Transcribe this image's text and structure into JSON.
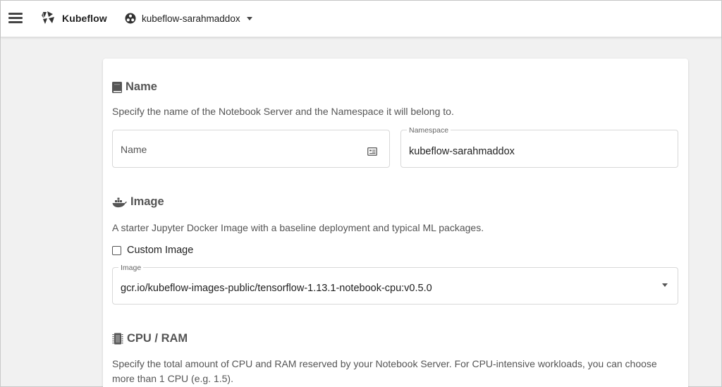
{
  "topbar": {
    "brand": "Kubeflow",
    "namespace_selector": "kubeflow-sarahmaddox",
    "icons": [
      "menu-icon",
      "kubeflow-logo",
      "namespace-icon",
      "caret-down-icon"
    ]
  },
  "name_section": {
    "title": "Name",
    "description": "Specify the name of the Notebook Server and the Namespace it will belong to.",
    "name_field": {
      "placeholder": "Name",
      "value": ""
    },
    "namespace_field": {
      "label": "Namespace",
      "value": "kubeflow-sarahmaddox"
    }
  },
  "image_section": {
    "title": "Image",
    "description": "A starter Jupyter Docker Image with a baseline deployment and typical ML packages.",
    "custom_image_label": "Custom Image",
    "custom_image_checked": false,
    "image_field": {
      "label": "Image",
      "value": "gcr.io/kubeflow-images-public/tensorflow-1.13.1-notebook-cpu:v0.5.0"
    }
  },
  "cpu_section": {
    "title": "CPU / RAM",
    "description_line1": "Specify the total amount of CPU and RAM reserved by your Notebook Server. For CPU-intensive workloads, you can choose",
    "description_line2": "more than 1 CPU (e.g. 1.5)."
  },
  "colors": {
    "topbar_bg": "#ffffff",
    "page_bg": "#f1f1f1",
    "section_title": "#555555"
  }
}
